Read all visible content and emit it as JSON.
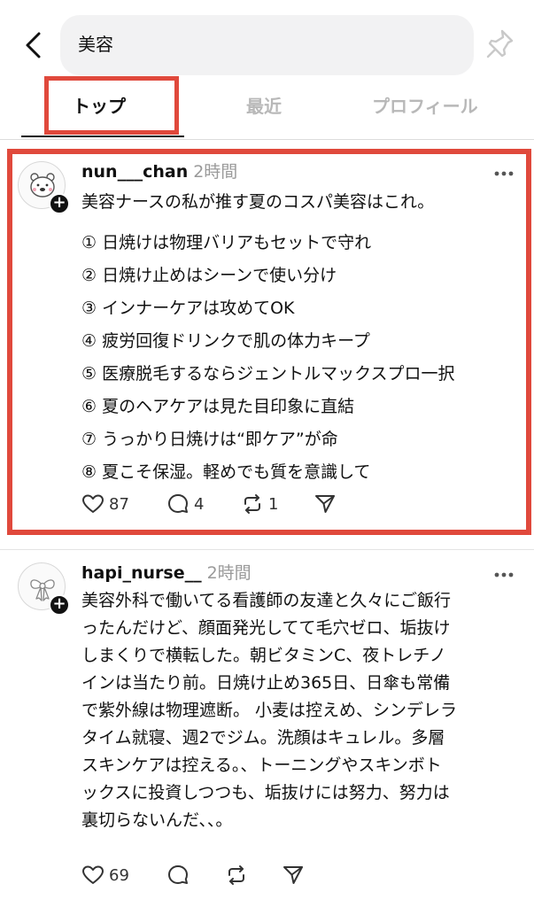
{
  "search": {
    "query": "美容"
  },
  "tabs": [
    {
      "label": "トップ"
    },
    {
      "label": "最近"
    },
    {
      "label": "プロフィール"
    }
  ],
  "posts": [
    {
      "username": "nun___chan",
      "time": "2時間",
      "intro": "美容ナースの私が推す夏のコスパ美容はこれ。",
      "items": [
        "① 日焼けは物理バリアもセットで守れ",
        "② 日焼け止めはシーンで使い分け",
        "③ インナーケアは攻めてOK",
        "④ 疲労回復ドリンクで肌の体力キープ",
        "⑤ 医療脱毛するならジェントルマックスプロ一択",
        "⑥ 夏のヘアケアは見た目印象に直結",
        "⑦ うっかり日焼けは“即ケア”が命",
        "⑧ 夏こそ保湿。軽めでも質を意識して"
      ],
      "likes": "87",
      "replies": "4",
      "reposts": "1"
    },
    {
      "username": "hapi_nurse__",
      "time": "2時間",
      "lines": [
        "美容外科で働いてる看護師の友達と久々にご飯行",
        "ったんだけど、顔面発光してて毛穴ゼロ、垢抜け",
        "しまくりで横転した。朝ビタミンC、夜トレチノ",
        "インは当たり前。日焼け止め365日、日傘も常備",
        "で紫外線は物理遮断。 小麦は控えめ、シンデレラ",
        "タイム就寝、週2でジム。洗顔はキュレル。多層",
        "スキンケアは控える。、トーニングやスキンボト",
        "ックスに投資しつつも、垢抜けには努力、努力は",
        "裏切らないんだ、、。"
      ],
      "likes": "69"
    }
  ],
  "icons": [
    "back-arrow-icon",
    "pin-icon",
    "more-icon",
    "heart-icon",
    "reply-icon",
    "repost-icon",
    "share-icon",
    "plus-icon"
  ],
  "colors": {
    "highlight": "#e0493c",
    "muted": "#9a9a9a",
    "search_bg": "#f2f2f3"
  }
}
